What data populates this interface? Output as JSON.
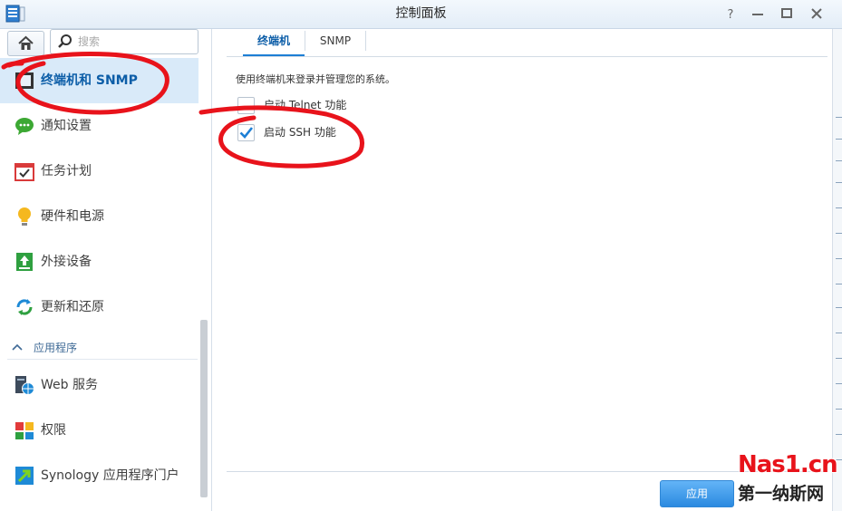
{
  "window": {
    "title": "控制面板",
    "controls": {
      "help": "?",
      "minimize": "—",
      "maximize": "□",
      "close": "✕"
    }
  },
  "sidebar": {
    "search_placeholder": "搜索",
    "items": [
      {
        "label": "终端机和 SNMP",
        "icon": "terminal-icon",
        "active": true
      },
      {
        "label": "通知设置",
        "icon": "chat-bubble-icon"
      },
      {
        "label": "任务计划",
        "icon": "calendar-check-icon"
      },
      {
        "label": "硬件和电源",
        "icon": "lightbulb-icon"
      },
      {
        "label": "外接设备",
        "icon": "external-device-icon"
      },
      {
        "label": "更新和还原",
        "icon": "refresh-icon"
      }
    ],
    "group": {
      "label": "应用程序",
      "icon": "chevron-up-icon"
    },
    "app_items": [
      {
        "label": "Web 服务",
        "icon": "web-service-icon"
      },
      {
        "label": "权限",
        "icon": "privileges-icon"
      },
      {
        "label": "Synology 应用程序门户",
        "icon": "portal-icon"
      }
    ]
  },
  "main": {
    "tabs": [
      {
        "label": "终端机",
        "active": true
      },
      {
        "label": "SNMP",
        "active": false
      }
    ],
    "description": "使用终端机来登录并管理您的系统。",
    "options": [
      {
        "label": "启动 Telnet 功能",
        "checked": false
      },
      {
        "label": "启动 SSH 功能",
        "checked": true
      }
    ],
    "apply_label": "应用"
  },
  "watermark": {
    "line1": "Nas1.cn",
    "line2": "第一纳斯网"
  },
  "colors": {
    "accent": "#1d7fd5",
    "active_bg": "#d9eaf9",
    "annotation": "#e8131b"
  }
}
